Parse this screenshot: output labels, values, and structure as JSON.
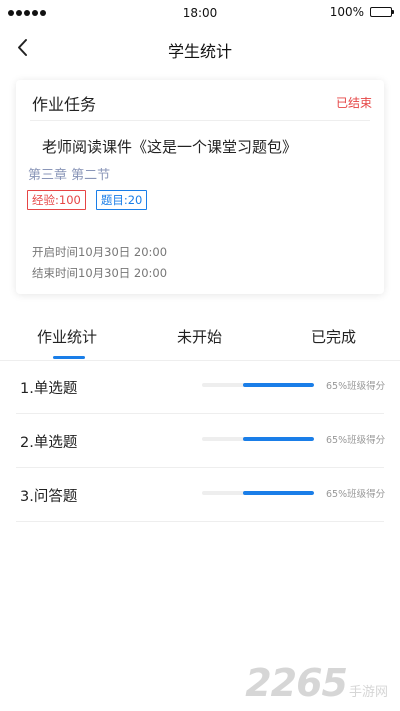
{
  "status_bar": {
    "time": "18:00",
    "battery": "100%"
  },
  "nav": {
    "title": "学生统计",
    "back_icon": "chevron-left-icon"
  },
  "card": {
    "title": "作业任务",
    "status": "已结束",
    "course": "老师阅读课件《这是一个课堂习题包》",
    "chapter": "第三章 第二节",
    "tag_exp": "经验:100",
    "tag_questions": "题目:20",
    "start_time": "开启时间10月30日 20:00",
    "end_time": "结束时间10月30日 20:00"
  },
  "tabs": [
    {
      "label": "作业统计",
      "active": true
    },
    {
      "label": "未开始",
      "active": false
    },
    {
      "label": "已完成",
      "active": false
    }
  ],
  "questions": [
    {
      "name": "1.单选题",
      "progress": 0.63,
      "score": "65%班级得分"
    },
    {
      "name": "2.单选题",
      "progress": 0.63,
      "score": "65%班级得分"
    },
    {
      "name": "3.问答题",
      "progress": 0.63,
      "score": "65%班级得分"
    }
  ],
  "colors": {
    "accent": "#1a7ee8",
    "danger": "#e64545"
  },
  "watermark": {
    "number": "2265",
    "text": "手游网"
  }
}
